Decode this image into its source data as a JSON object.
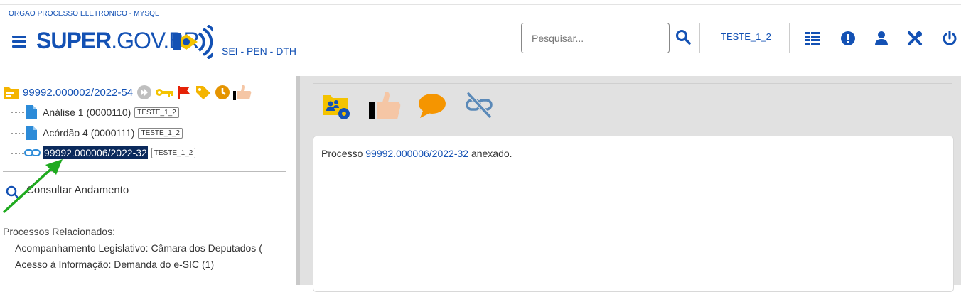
{
  "header": {
    "org_name": "ORGAO PROCESSO ELETRONICO - MYSQL",
    "logo_bold": "SUPER",
    "logo_rest": ".GOV.BR",
    "subsystem": "SEI - PEN - DTH",
    "search_placeholder": "Pesquisar...",
    "user": "TESTE_1_2",
    "icons": [
      "menu-icon",
      "search-icon",
      "units-icon",
      "alert-icon",
      "user-icon",
      "tools-icon",
      "power-icon"
    ]
  },
  "tree": {
    "process": "99992.000002/2022-54",
    "process_icons": [
      "folder-icon",
      "forward-icon",
      "key-icon",
      "flag-icon",
      "tag-icon",
      "clock-icon",
      "thumbs-up-icon"
    ],
    "items": [
      {
        "label": "Análise 1 (0000110)",
        "tag": "TESTE_1_2"
      },
      {
        "label": "Acórdão 4 (0000111)",
        "tag": "TESTE_1_2"
      },
      {
        "label": "99992.000006/2022-32",
        "tag": "TESTE_1_2"
      }
    ]
  },
  "consultar": "Consultar Andamento",
  "related": {
    "title": "Processos Relacionados:",
    "items": [
      "Acompanhamento Legislativo: Câmara dos Deputados (",
      "Acesso à Informação: Demanda do e-SIC (1)"
    ]
  },
  "toolbar_icons": [
    "manage-folder-icon",
    "thumbs-up-icon",
    "comment-icon",
    "unlink-icon"
  ],
  "content": {
    "prefix": "Processo",
    "link": "99992.000006/2022-32",
    "suffix": "anexado."
  },
  "colors": {
    "primary": "#1351b4",
    "selected_bg": "#0b2a5c",
    "annotation_arrow": "#1faa1f"
  }
}
